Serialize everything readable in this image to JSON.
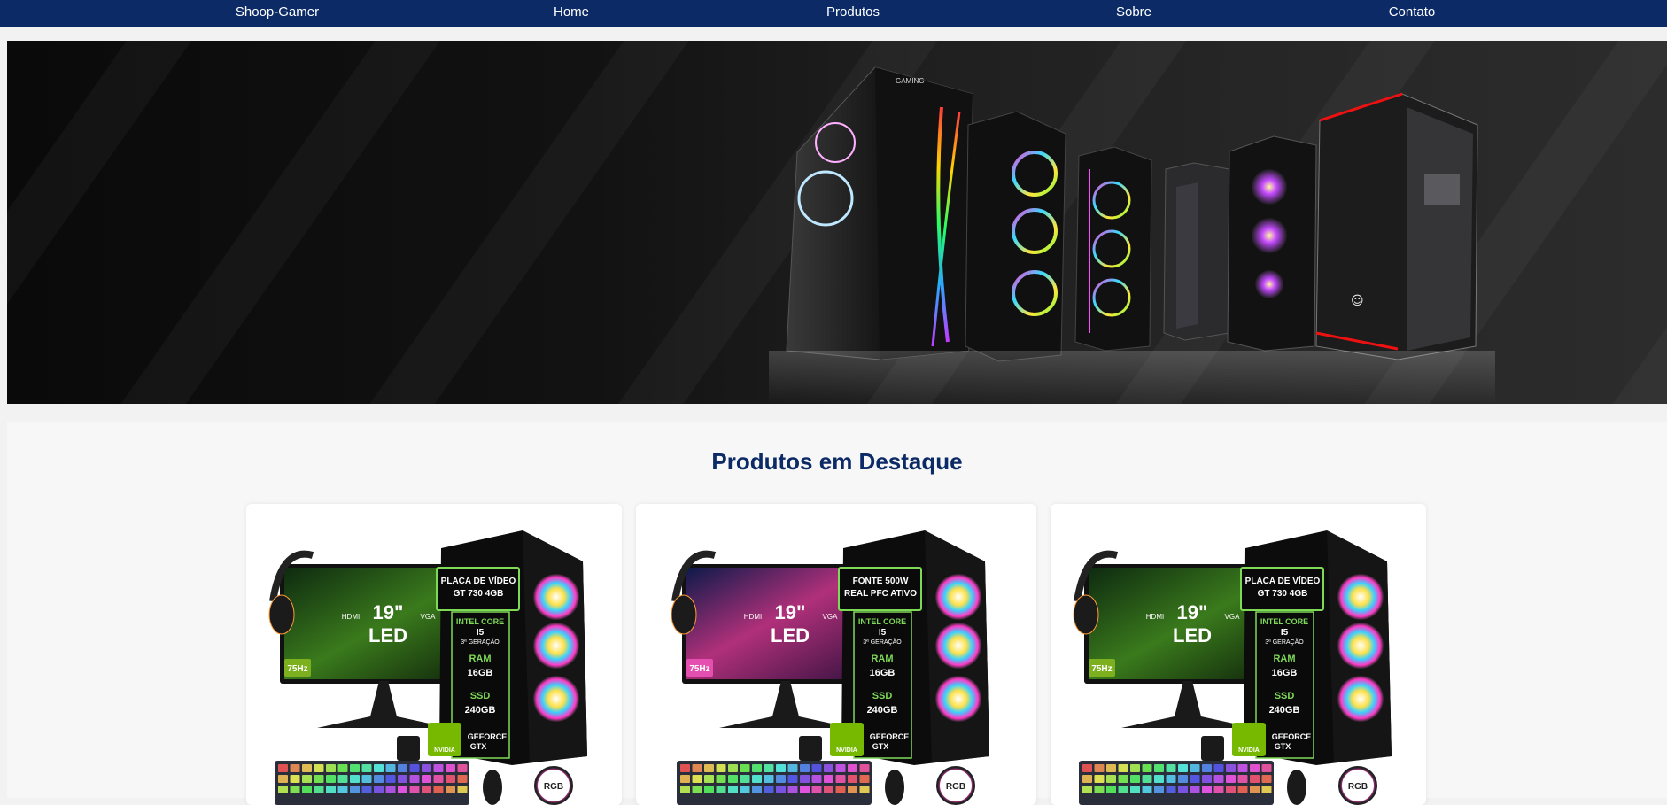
{
  "nav": {
    "brand": "Shoop-Gamer",
    "items": [
      {
        "label": "Home"
      },
      {
        "label": "Produtos"
      },
      {
        "label": "Sobre"
      },
      {
        "label": "Contato"
      }
    ]
  },
  "featured": {
    "title": "Produtos em Destaque",
    "products": [
      {
        "screen": "19\"",
        "screen_type": "LED",
        "hz": "75Hz",
        "port1": "HDMI",
        "port2": "VGA",
        "feature_line1": "PLACA DE VÍDEO",
        "feature_line2": "GT 730 4GB",
        "cpu_label": "INTEL CORE",
        "cpu_model": "I5",
        "cpu_gen": "3ª GERAÇÃO",
        "ram_label": "RAM",
        "ram_value": "16GB",
        "ssd_label": "SSD",
        "ssd_value": "240GB",
        "gpu_brand": "NVIDIA",
        "gpu_line1": "GEFORCE",
        "gpu_line2": "GTX",
        "rgb": "RGB",
        "wallpaper": "green"
      },
      {
        "screen": "19\"",
        "screen_type": "LED",
        "hz": "75Hz",
        "port1": "HDMI",
        "port2": "VGA",
        "feature_line1": "FONTE 500W",
        "feature_line2": "REAL PFC ATIVO",
        "cpu_label": "INTEL CORE",
        "cpu_model": "I5",
        "cpu_gen": "3ª GERAÇÃO",
        "ram_label": "RAM",
        "ram_value": "16GB",
        "ssd_label": "SSD",
        "ssd_value": "240GB",
        "gpu_brand": "NVIDIA",
        "gpu_line1": "GEFORCE",
        "gpu_line2": "GTX",
        "rgb": "RGB",
        "wallpaper": "cyberpunk"
      },
      {
        "screen": "19\"",
        "screen_type": "LED",
        "hz": "75Hz",
        "port1": "HDMI",
        "port2": "VGA",
        "feature_line1": "PLACA DE VÍDEO",
        "feature_line2": "GT 730 4GB",
        "cpu_label": "INTEL CORE",
        "cpu_model": "I5",
        "cpu_gen": "3ª GERAÇÃO",
        "ram_label": "RAM",
        "ram_value": "16GB",
        "ssd_label": "SSD",
        "ssd_value": "240GB",
        "gpu_brand": "NVIDIA",
        "gpu_line1": "GEFORCE",
        "gpu_line2": "GTX",
        "rgb": "RGB",
        "wallpaper": "green"
      }
    ]
  },
  "colors": {
    "nav_bg": "#0b2a66",
    "title": "#0b2a66",
    "spec_green": "#7ed957"
  }
}
